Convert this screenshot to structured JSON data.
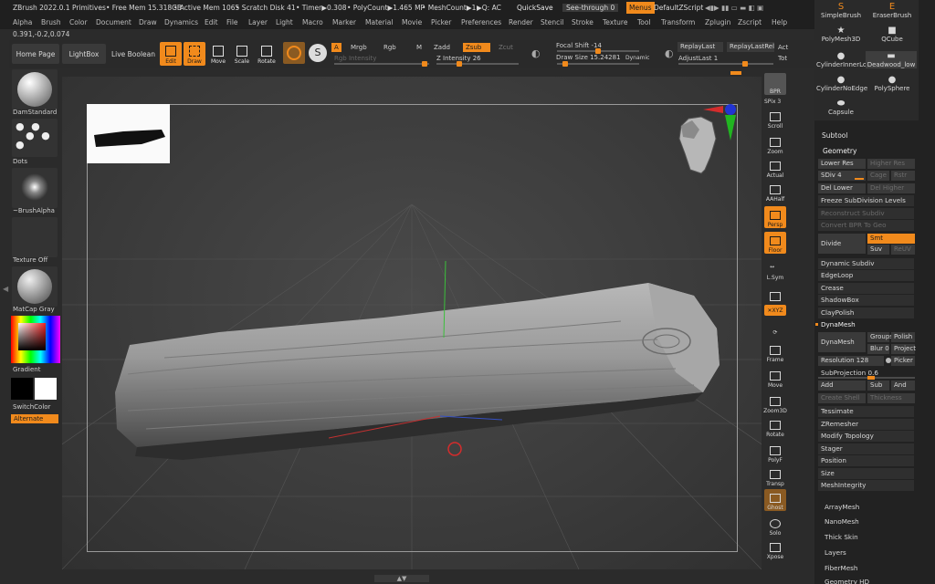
{
  "status": {
    "app": "ZBrush 2022.0.1 Primitives",
    "free_mem": "• Free Mem 15.318GB",
    "active_mem": "• Active Mem 1065",
    "scratch_disk": "• Scratch Disk 41",
    "timer": "• Timer▶0.308",
    "poly_count": "• PolyCount▶1.465 MP",
    "mesh_count": "• MeshCount▶1",
    "quicksave": "QuickSave",
    "see_through": "See-through  0",
    "menus": "Menus",
    "script": "DefaultZScript"
  },
  "menu": [
    "Alpha",
    "Brush",
    "Color",
    "Document",
    "Draw",
    "Dynamics",
    "Edit",
    "File",
    "Layer",
    "Light",
    "Macro",
    "Marker",
    "Material",
    "Movie",
    "Picker",
    "Preferences",
    "Render",
    "Stencil",
    "Stroke",
    "Texture",
    "Tool",
    "Transform",
    "Zplugin",
    "Zscript",
    "Help"
  ],
  "coords": "0.391,-0.2,0.074",
  "shelf": {
    "home": "Home Page",
    "lightbox": "LightBox",
    "live_boolean": "Live Boolean",
    "edit": "Edit",
    "draw": "Draw",
    "move": "Move",
    "scale": "Scale",
    "rotate": "Rotate",
    "a": "A",
    "mrgb": "Mrgb",
    "rgb": "Rgb",
    "m": "M",
    "zadd": "Zadd",
    "zsub": "Zsub",
    "zcut": "Zcut",
    "rgb_intensity": "Rgb Intensity",
    "z_intensity": "Z Intensity 26",
    "focal_shift": "Focal Shift -14",
    "draw_size": "Draw Size 15.24281",
    "dynamic": "Dynamic",
    "replay_last": "ReplayLast",
    "replay_last_rel": "ReplayLastRel",
    "adjust_last": "AdjustLast 1",
    "act": "Act",
    "tot": "Tot"
  },
  "left": {
    "brush": "DamStandard",
    "stroke": "Dots",
    "alpha": "~BrushAlpha",
    "texture": "Texture Off",
    "material": "MatCap Gray",
    "gradient": "Gradient",
    "switch_color": "SwitchColor",
    "alternate": "Alternate"
  },
  "dock": {
    "bpr": "BPR",
    "spix": "SPix 3",
    "scroll": "Scroll",
    "zoom": "Zoom",
    "actual": "Actual",
    "aahalf": "AAHalf",
    "persp": "Persp",
    "floor": "Floor",
    "lsym": "L.Sym",
    "xyz": "✕XYZ",
    "frame": "Frame",
    "move": "Move",
    "zoom3d": "Zoom3D",
    "rotate": "Rotate",
    "polyf": "PolyF",
    "transp": "Transp",
    "ghost": "Ghost",
    "solo": "Solo",
    "xpose": "Xpose"
  },
  "tools": {
    "simple_brush": "SimpleBrush",
    "eraser_brush": "EraserBrush",
    "polymesh3d": "PolyMesh3D",
    "qcube": "QCube",
    "cyl_inner": "CylinderInnerLo",
    "deadwood": "Deadwood_low",
    "cyl_noedge": "CylinderNoEdge",
    "polysphere": "PolySphere",
    "capsule": "Capsule"
  },
  "panel": {
    "subtool": "Subtool",
    "geometry": "Geometry",
    "lower_res": "Lower Res",
    "higher_res": "Higher Res",
    "sdiv": "SDiv 4",
    "cage": "Cage",
    "rstr": "Rstr",
    "del_lower": "Del Lower",
    "del_higher": "Del Higher",
    "freeze": "Freeze SubDivision Levels",
    "reconstruct": "Reconstruct Subdiv",
    "convert_bpr": "Convert BPR To Geo",
    "divide": "Divide",
    "smt": "Smt",
    "suv": "Suv",
    "reuv": "ReUV",
    "dynamic_subdiv": "Dynamic Subdiv",
    "edgeloop": "EdgeLoop",
    "crease": "Crease",
    "shadowbox": "ShadowBox",
    "claypolish": "ClayPolish",
    "dynamesh_head": "DynaMesh",
    "dynamesh": "DynaMesh",
    "groups": "Groups",
    "polish": "Polish",
    "blur": "Blur 0",
    "project": "Project",
    "resolution": "Resolution 128",
    "picker": "Picker",
    "subprojection": "SubProjection 0.6",
    "add": "Add",
    "sub": "Sub",
    "and": "And",
    "create_shell": "Create Shell",
    "thickness": "Thickness",
    "tessimate": "Tessimate",
    "zremesher": "ZRemesher",
    "modify_topology": "Modify Topology",
    "stager": "Stager",
    "position": "Position",
    "size": "Size",
    "meshintegrity": "MeshIntegrity",
    "arraymesh": "ArrayMesh",
    "nanomesh": "NanoMesh",
    "thick_skin": "Thick Skin",
    "layers": "Layers",
    "fibermesh": "FiberMesh",
    "geometry_hd": "Geometry HD"
  },
  "colors": {
    "accent": "#f18a1c",
    "panel": "#222222",
    "canvas": "#3f3f3f"
  }
}
